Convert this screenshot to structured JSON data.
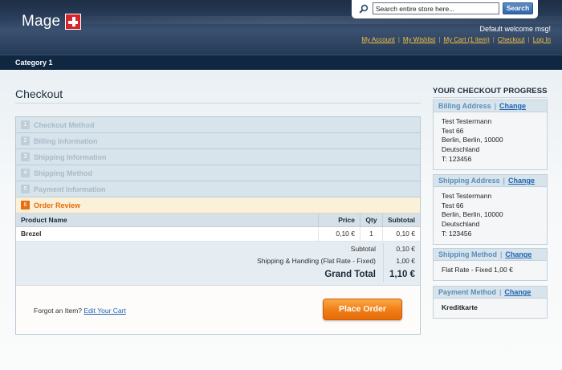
{
  "header": {
    "logo_text": "Mage",
    "search": {
      "placeholder": "Search entire store here...",
      "button": "Search"
    },
    "welcome": "Default welcome msg!",
    "links": [
      "My Account",
      "My Wishlist",
      "My Cart (1 item)",
      "Checkout",
      "Log In"
    ]
  },
  "nav": {
    "items": [
      "Category 1"
    ]
  },
  "checkout": {
    "title": "Checkout",
    "steps": [
      {
        "num": "1",
        "label": "Checkout Method"
      },
      {
        "num": "2",
        "label": "Billing Information"
      },
      {
        "num": "3",
        "label": "Shipping Information"
      },
      {
        "num": "4",
        "label": "Shipping Method"
      },
      {
        "num": "5",
        "label": "Payment Information"
      },
      {
        "num": "6",
        "label": "Order Review"
      }
    ],
    "active_step": 6,
    "review": {
      "columns": [
        "Product Name",
        "Price",
        "Qty",
        "Subtotal"
      ],
      "rows": [
        {
          "name": "Brezel",
          "price": "0,10 €",
          "qty": "1",
          "subtotal": "0,10 €"
        }
      ],
      "totals": {
        "subtotal_label": "Subtotal",
        "subtotal_value": "0,10 €",
        "shipping_label": "Shipping & Handling (Flat Rate - Fixed)",
        "shipping_value": "1,00 €",
        "grand_label": "Grand Total",
        "grand_value": "1,10 €"
      },
      "forgot_text": "Forgot an Item?",
      "edit_cart": "Edit Your Cart",
      "place_order": "Place Order"
    }
  },
  "progress": {
    "title": "YOUR CHECKOUT PROGRESS",
    "change_label": "Change",
    "billing": {
      "title": "Billing Address",
      "lines": [
        "Test Testermann",
        "Test 66",
        "Berlin, Berlin, 10000",
        "Deutschland",
        "T: 123456"
      ]
    },
    "shipping": {
      "title": "Shipping Address",
      "lines": [
        "Test Testermann",
        "Test 66",
        "Berlin, Berlin, 10000",
        "Deutschland",
        "T: 123456"
      ]
    },
    "shipping_method": {
      "title": "Shipping Method",
      "value": "Flat Rate - Fixed 1,00 €"
    },
    "payment_method": {
      "title": "Payment Method",
      "value": "Kreditkarte"
    }
  },
  "colors": {
    "accent": "#e76c12",
    "link": "#1e62b0",
    "header": "#243a56",
    "nav": "#0f2740"
  }
}
